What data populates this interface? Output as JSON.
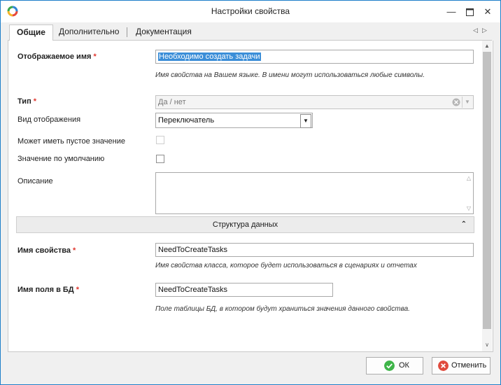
{
  "window": {
    "title": "Настройки свойства"
  },
  "tabs": [
    {
      "label": "Общие"
    },
    {
      "label": "Дополнительно"
    },
    {
      "label": "Документация"
    }
  ],
  "form": {
    "display_name": {
      "label": "Отображаемое имя",
      "required_mark": "*",
      "value": "Необходимо создать задачи",
      "hint": "Имя свойства на Вашем языке. В имени могут использоваться любые символы."
    },
    "type": {
      "label": "Тип",
      "required_mark": "*",
      "value": "Да / нет"
    },
    "display_kind": {
      "label": "Вид отображения",
      "value": "Переключатель"
    },
    "nullable": {
      "label": "Может иметь пустое значение",
      "checked": false,
      "disabled": true
    },
    "default_value": {
      "label": "Значение по умолчанию",
      "checked": false
    },
    "description": {
      "label": "Описание",
      "value": ""
    },
    "section_data_structure": {
      "label": "Структура данных"
    },
    "property_name": {
      "label": "Имя свойства",
      "required_mark": "*",
      "value": "NeedToCreateTasks",
      "hint": "Имя свойства класса, которое будет использоваться в сценариях и отчетах"
    },
    "db_field_name": {
      "label": "Имя поля в БД",
      "required_mark": "*",
      "value": "NeedToCreateTasks",
      "hint": "Поле таблицы БД, в котором будут храниться значения данного свойства."
    }
  },
  "buttons": {
    "ok": "ОК",
    "cancel": "Отменить"
  },
  "colors": {
    "window_border": "#1e7fc9",
    "required": "#e0362e",
    "ok_icon": "#3fb549",
    "cancel_icon": "#e04b3e",
    "selection": "#3b8ed8"
  }
}
